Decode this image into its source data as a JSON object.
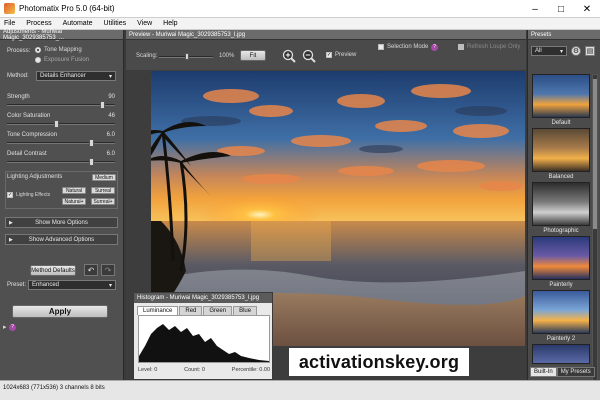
{
  "window": {
    "title": "Photomatix Pro 5.0 (64-bit)",
    "min": "–",
    "max": "□",
    "close": "✕"
  },
  "menu": [
    "File",
    "Process",
    "Automate",
    "Utilities",
    "View",
    "Help"
  ],
  "adjustments": {
    "header": "Adjustments - Muriwai Magic_3029385753_...",
    "process_label": "Process:",
    "process_options": [
      "Tone Mapping",
      "Exposure Fusion"
    ],
    "method_label": "Method:",
    "method_value": "Details Enhancer",
    "sliders": [
      {
        "label": "Strength",
        "value": "90",
        "fraction": 0.9
      },
      {
        "label": "Color Saturation",
        "value": "46",
        "fraction": 0.46
      },
      {
        "label": "Tone Compression",
        "value": "6.0",
        "fraction": 0.8
      },
      {
        "label": "Detail Contrast",
        "value": "6.0",
        "fraction": 0.8
      }
    ],
    "lighting_title": "Lighting Adjustments",
    "lighting_effects": "Lighting Effects",
    "lighting_buttons": [
      "Medium",
      "Natural",
      "Surreal",
      "Natural+",
      "Surreal+"
    ],
    "show_more": "Show More Options",
    "show_advanced": "Show Advanced Options",
    "method_defaults": "Method Defaults",
    "preset_label": "Preset:",
    "preset_value": "Enhanced",
    "apply": "Apply"
  },
  "preview": {
    "header": "Preview - Muriwai Magic_3029385753_l.jpg",
    "scaling_label": "Scaling:",
    "scaling_value": "100%",
    "fit": "Fit",
    "preview_label": "Preview",
    "selection_mode": "Selection Mode",
    "refresh": "Refresh Loupe Only"
  },
  "histogram": {
    "header": "Histogram - Muriwai Magic_3029385753_l.jpg",
    "tabs": [
      "Luminance",
      "Red",
      "Green",
      "Blue"
    ],
    "level": "Level: 0",
    "count": "Count: 0",
    "percentile": "Percentile: 0.00"
  },
  "watermark": "activationskey.org",
  "presets": {
    "header": "Presets",
    "filter": "All",
    "items": [
      "Default",
      "Balanced",
      "Photographic",
      "Painterly",
      "Painterly 2"
    ],
    "tabs": [
      "Built-In",
      "My Presets"
    ]
  },
  "status": "1024x683 (771x536) 3 channels 8 bits",
  "colors": {
    "panel": "#505050",
    "header": "#6b6b6b",
    "accent": "#a64aa6"
  }
}
